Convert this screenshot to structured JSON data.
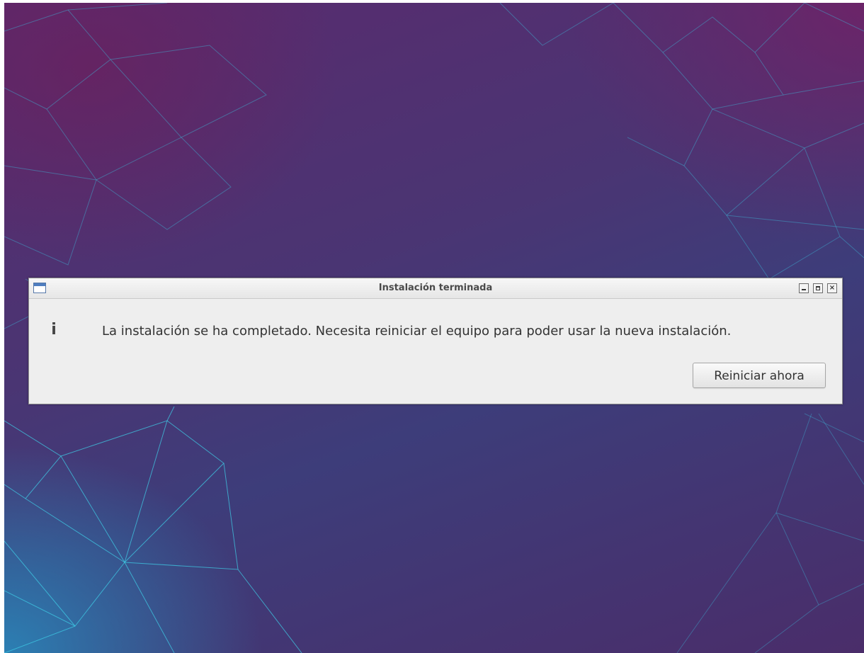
{
  "dialog": {
    "title": "Instalación terminada",
    "message": "La instalación se ha completado. Necesita reiniciar el equipo para poder usar la nueva instalación.",
    "info_icon_glyph": "i",
    "restart_button_label": "Reiniciar ahora"
  },
  "icons": {
    "app": "window-icon",
    "info": "info-icon",
    "minimize": "minimize-icon",
    "maximize": "maximize-icon",
    "close": "close-icon"
  },
  "colors": {
    "wallpaper_base": "#4a3573",
    "wallpaper_lines": "#3fb5d8",
    "dialog_background": "#eeeeee"
  }
}
